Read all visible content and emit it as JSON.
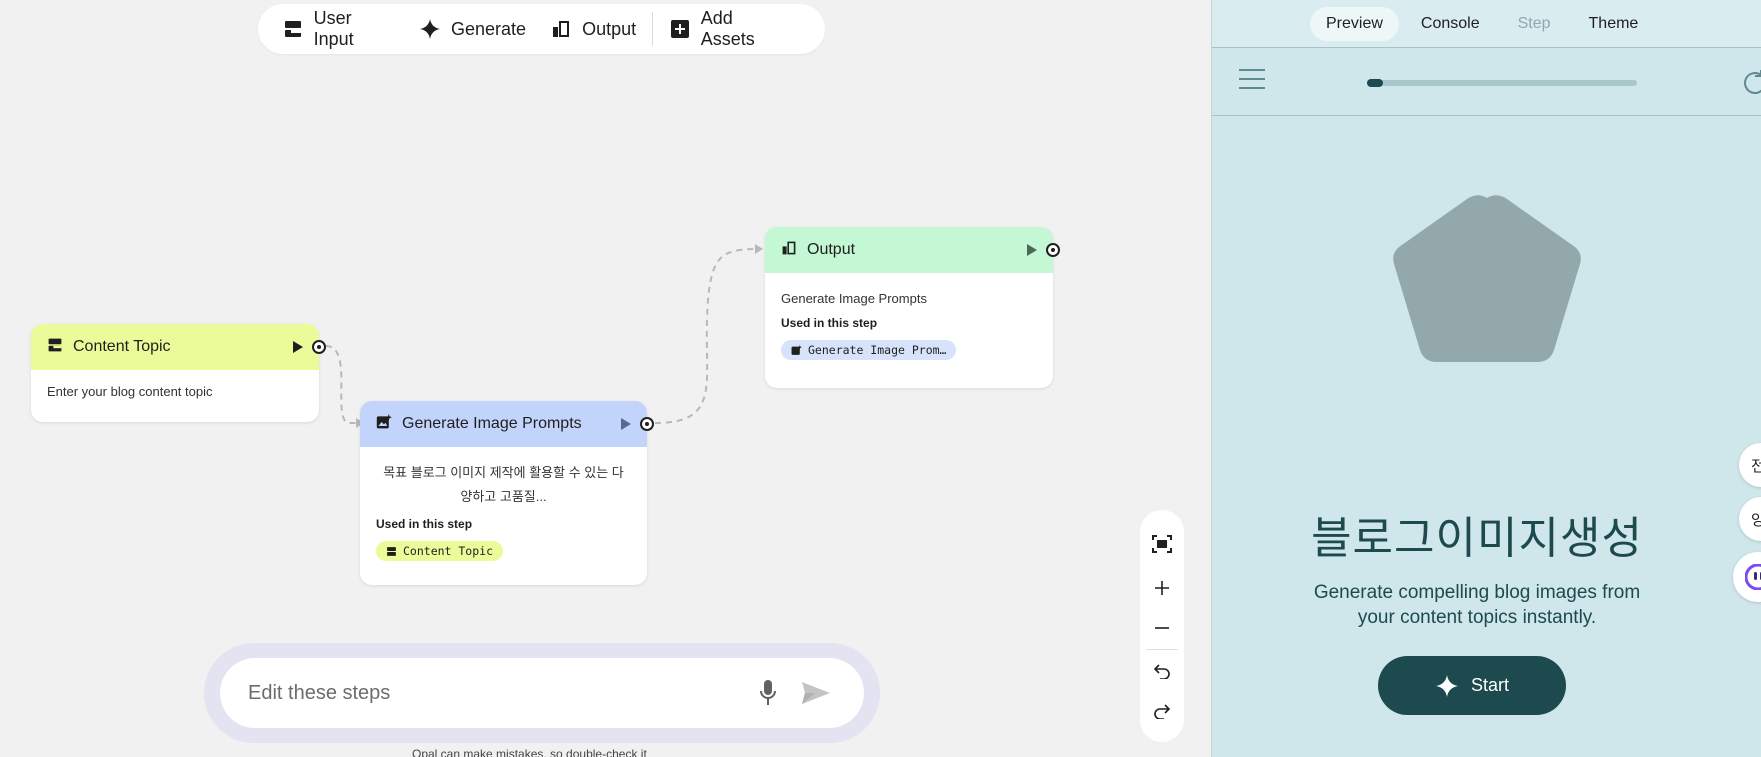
{
  "toolbar": {
    "items": [
      {
        "label": "User Input",
        "icon": "user-input-icon"
      },
      {
        "label": "Generate",
        "icon": "sparkle-icon"
      },
      {
        "label": "Output",
        "icon": "output-icon"
      },
      {
        "label": "Add Assets",
        "icon": "add-box-icon"
      }
    ]
  },
  "nodes": {
    "content_topic": {
      "title": "Content Topic",
      "color": "#ecfb99",
      "body": "Enter your blog content topic"
    },
    "generate_prompts": {
      "title": "Generate Image Prompts",
      "color": "#c2d4fb",
      "body": "목표 블로그 이미지 제작에 활용할 수 있는 다양하고 고품질...",
      "used_label": "Used in this step",
      "chip": "Content Topic",
      "chip_color": "#ecfb99"
    },
    "output": {
      "title": "Output",
      "color": "#c4f7d4",
      "body": "Generate Image Prompts",
      "used_label": "Used in this step",
      "chip": "Generate Image Prom…",
      "chip_color": "#d7e3fb"
    }
  },
  "prompt": {
    "placeholder": "Edit these steps",
    "disclaimer": "Opal can make mistakes, so double-check it"
  },
  "panel": {
    "tabs": [
      {
        "label": "Preview",
        "state": "active"
      },
      {
        "label": "Console",
        "state": "normal"
      },
      {
        "label": "Step",
        "state": "disabled"
      },
      {
        "label": "Theme",
        "state": "normal"
      }
    ],
    "progress": 0.02,
    "app_title": "블로그이미지생성",
    "app_subtitle": "Generate compelling blog images from your content topics instantly.",
    "start_label": "Start",
    "side_buttons": [
      "전",
      "잉"
    ],
    "accent": "#1d4a4e",
    "background": "#cfe6ea"
  }
}
